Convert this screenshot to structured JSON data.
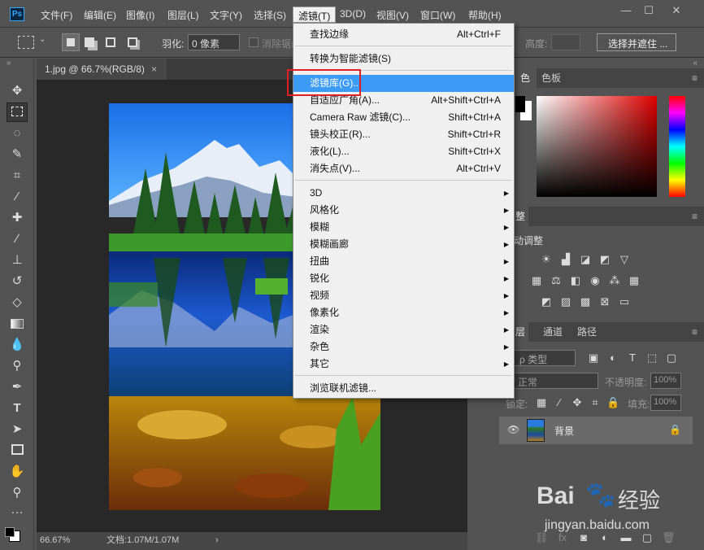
{
  "app": {
    "logo": "Ps"
  },
  "menubar": {
    "items": [
      "文件(F)",
      "编辑(E)",
      "图像(I)",
      "图层(L)",
      "文字(Y)",
      "选择(S)",
      "滤镜(T)",
      "3D(D)",
      "视图(V)",
      "窗口(W)",
      "帮助(H)"
    ]
  },
  "window_controls": {
    "minimize": "—",
    "restore": "☐",
    "close": "✕"
  },
  "options": {
    "feather_label": "羽化:",
    "feather_value": "0 像素",
    "antialias_label": "消除锯齿",
    "height_label": "高度:",
    "select_mask_button": "选择并遮住 ..."
  },
  "document": {
    "tab_title": "1.jpg @ 66.7%(RGB/8)",
    "tab_close": "×"
  },
  "status": {
    "zoom": "66.67%",
    "doc_label": "文档:1.07M/1.07M",
    "arrow": "›"
  },
  "color_panel": {
    "tab_active": "色",
    "tab_swatches": "色板"
  },
  "adjustments_panel": {
    "tab": "整",
    "subtitle": "动调整"
  },
  "layers_panel": {
    "tab_layers": "层",
    "tab_channels": "通道",
    "tab_paths": "路径",
    "kind_label": "ρ 类型",
    "blend_mode": "正常",
    "opacity_label": "不透明度:",
    "opacity_value": "100%",
    "lock_label": "锁定:",
    "fill_label": "填充:",
    "fill_value": "100%",
    "layer_name": "背景"
  },
  "filter_menu": {
    "items": [
      {
        "label": "查找边缘",
        "shortcut": "Alt+Ctrl+F"
      },
      {
        "label": "转换为智能滤镜(S)",
        "shortcut": ""
      },
      {
        "label": "滤镜库(G)...",
        "shortcut": ""
      },
      {
        "label": "自适应广角(A)...",
        "shortcut": "Alt+Shift+Ctrl+A"
      },
      {
        "label": "Camera Raw 滤镜(C)...",
        "shortcut": "Shift+Ctrl+A"
      },
      {
        "label": "镜头校正(R)...",
        "shortcut": "Shift+Ctrl+R"
      },
      {
        "label": "液化(L)...",
        "shortcut": "Shift+Ctrl+X"
      },
      {
        "label": "消失点(V)...",
        "shortcut": "Alt+Ctrl+V"
      },
      {
        "label": "3D",
        "shortcut": ""
      },
      {
        "label": "风格化",
        "shortcut": ""
      },
      {
        "label": "模糊",
        "shortcut": ""
      },
      {
        "label": "模糊画廊",
        "shortcut": ""
      },
      {
        "label": "扭曲",
        "shortcut": ""
      },
      {
        "label": "锐化",
        "shortcut": ""
      },
      {
        "label": "视频",
        "shortcut": ""
      },
      {
        "label": "像素化",
        "shortcut": ""
      },
      {
        "label": "渲染",
        "shortcut": ""
      },
      {
        "label": "杂色",
        "shortcut": ""
      },
      {
        "label": "其它",
        "shortcut": ""
      },
      {
        "label": "浏览联机滤镜...",
        "shortcut": ""
      }
    ],
    "submenu_arrow": "▶"
  },
  "watermark": {
    "brand": "Bai",
    "brand2": "经验",
    "url": "jingyan.baidu.com"
  },
  "colors": {
    "highlight": "#3c9bf5",
    "annotation": "#e02020",
    "app_bg": "#535353"
  }
}
